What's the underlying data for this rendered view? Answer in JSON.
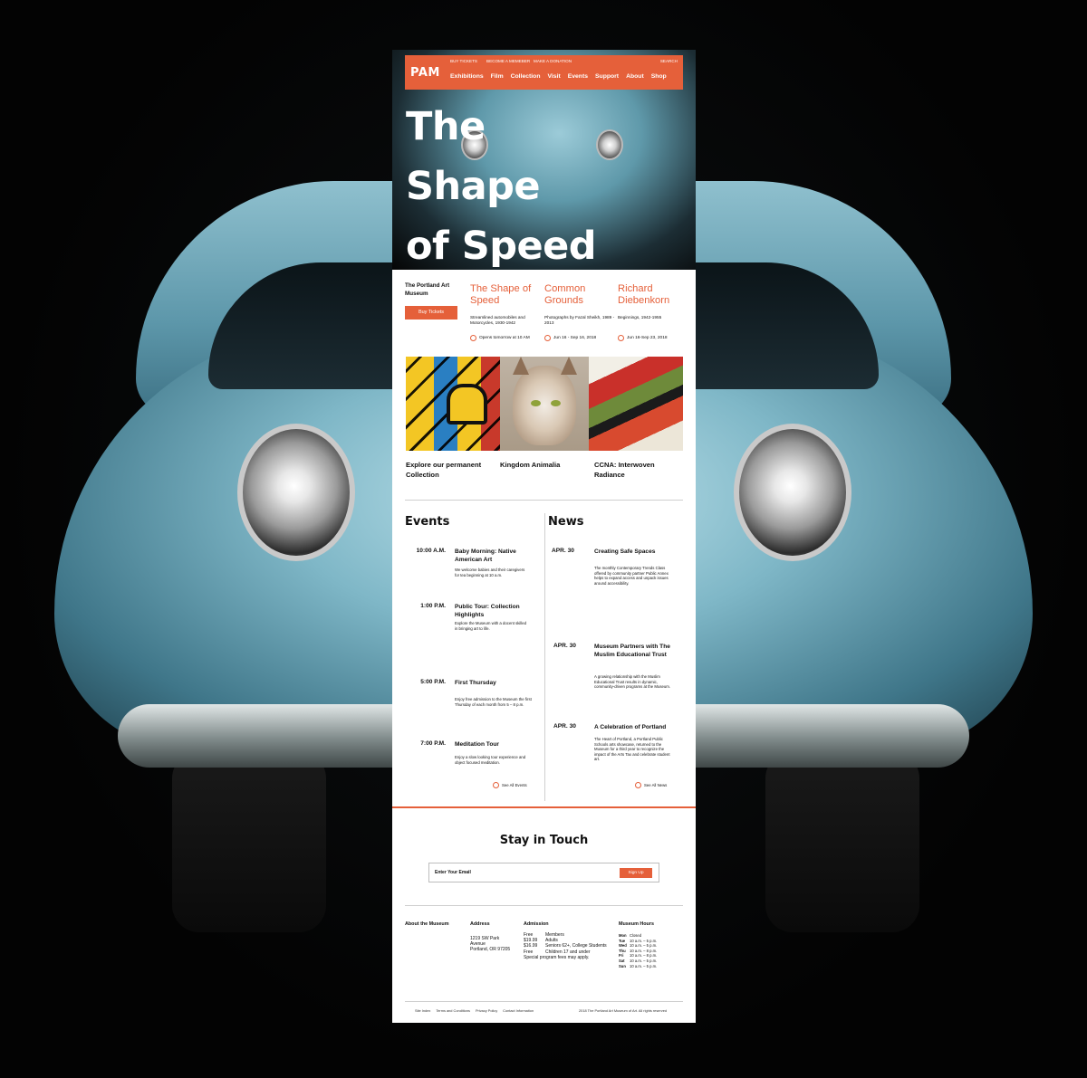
{
  "brand": {
    "logo": "PAM",
    "accent": "#e5603a"
  },
  "utility_nav": [
    "BUY TICKETS",
    "BECOME A MEMEBER",
    "MAKE A DONATION",
    "SEARCH"
  ],
  "main_nav": [
    "Exhibitions",
    "Film",
    "Collection",
    "Visit",
    "Events",
    "Support",
    "About",
    "Shop"
  ],
  "hero": {
    "line1": "The",
    "line2": "Shape",
    "line3": "of Speed"
  },
  "museum": {
    "name": "The Portland Art Museum",
    "buy_tickets": "Buy Tickets"
  },
  "exhibitions": [
    {
      "title": "The Shape of Speed",
      "desc": "Streamlined automobiles and Motorcycles, 1930-1942",
      "date": "Opens tomorrow at 10 AM"
    },
    {
      "title": "Common Grounds",
      "desc": "Photographs by Fazal Sheikh, 1989 - 2013",
      "date": "Jun 16 - Sep 16, 2018"
    },
    {
      "title": "Richard Diebenkorn",
      "desc": "Beginnings, 1942-1955",
      "date": "Jun 16-Sep 23, 2018"
    }
  ],
  "collections": [
    "Explore our permanent Collection",
    "Kingdom Animalia",
    "CCNA: Interwoven Radiance"
  ],
  "events": {
    "heading": "Events",
    "items": [
      {
        "time": "10:00 A.M.",
        "title": "Baby Morning: Native American Art",
        "desc": "We welcome babies and their caregivers for tea beginning at 10 a.m."
      },
      {
        "time": "1:00 P.M.",
        "title": "Public Tour: Collection Highlights",
        "desc": "Explore the Museum with a docent skilled in bringing art to life."
      },
      {
        "time": "5:00 P.M.",
        "title": "First Thursday",
        "desc": "Enjoy free admission to the Museum the first Thursday of each month from 5 – 8 p.m."
      },
      {
        "time": "7:00 P.M.",
        "title": "Meditation Tour",
        "desc": "Enjoy a slow looking tour experience and object focused meditation."
      }
    ],
    "see_all": "See All Events"
  },
  "news": {
    "heading": "News",
    "items": [
      {
        "date": "APR.  30",
        "title": "Creating Safe Spaces",
        "desc": "The monthly Contemporary Trends Class offered by community partner Public Annex helps to expand access and unpack issues around accessibility."
      },
      {
        "date": "APR.  30",
        "title": "Museum Partners with The Muslim Educational Trust",
        "desc": "A growing relationship with the Muslim Educational Trust results in dynamic, community-driven programs at the Museum."
      },
      {
        "date": "APR.  30",
        "title": "A Celebration of Portland",
        "desc": "The Heart of Portland, a Portland Public Schools arts showcase, returned to the Museum for a third year to recognize the impact of the Arts Tax and celebrate student art."
      }
    ],
    "see_all": "See All News"
  },
  "newsletter": {
    "title": "Stay in Touch",
    "placeholder": "Enter Your Email",
    "button": "Sign Up"
  },
  "footer": {
    "about": "About the Museum",
    "address_head": "Address",
    "address_lines": [
      "1219 SW Park",
      "Avenue",
      "Portland, OR 97205"
    ],
    "admission_head": "Admission",
    "admission": [
      {
        "price": "Free",
        "who": "Members"
      },
      {
        "price": "$19.99",
        "who": "Adults"
      },
      {
        "price": "$16.99",
        "who": "Seniors 62+, College Students"
      },
      {
        "price": "Free",
        "who": "Children 17 and under"
      }
    ],
    "admission_note": "Special program fees may apply.",
    "hours_head": "Museum Hours",
    "hours": [
      {
        "day": "Mon",
        "time": "Closed"
      },
      {
        "day": "Tue",
        "time": "10 a.m. – 5 p.m."
      },
      {
        "day": "Wed",
        "time": "10 a.m. – 5 p.m."
      },
      {
        "day": "Thu",
        "time": "10 a.m. – 8 p.m."
      },
      {
        "day": "Fri",
        "time": "10 a.m. – 8 p.m."
      },
      {
        "day": "Sat",
        "time": "10 a.m. – 5 p.m."
      },
      {
        "day": "Sun",
        "time": "10 a.m. – 5 p.m."
      }
    ],
    "links": [
      "Site Index",
      "Terms and Conditions",
      "Privacy Policy",
      "Contact Information"
    ],
    "copyright": "2018 The Portland Art Museum of Art. All rights reserved"
  }
}
